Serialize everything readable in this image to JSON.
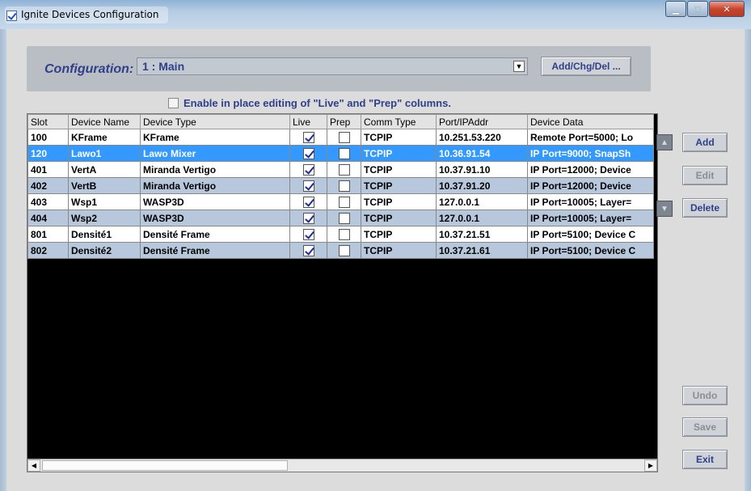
{
  "window": {
    "title": "Ignite Devices Configuration",
    "minimize_icon": "minimize-icon",
    "maximize_icon": "maximize-icon",
    "close_icon": "close-icon"
  },
  "config": {
    "label": "Configuration:",
    "selected": "1 : Main",
    "add_chg_del_label": "Add/Chg/Del ..."
  },
  "enable_editing": {
    "label": "Enable in place editing of \"Live\" and \"Prep\" columns.",
    "checked": false
  },
  "table": {
    "columns": [
      "Slot",
      "Device Name",
      "Device Type",
      "Live",
      "Prep",
      "Comm Type",
      "Port/IPAddr",
      "Device Data"
    ],
    "rows": [
      {
        "slot": "100",
        "name": "KFrame",
        "type": "KFrame",
        "live": true,
        "prep": false,
        "comm": "TCPIP",
        "addr": "10.251.53.220",
        "data": "Remote Port=5000; Lo"
      },
      {
        "slot": "120",
        "name": "Lawo1",
        "type": "Lawo Mixer",
        "live": true,
        "prep": false,
        "comm": "TCPIP",
        "addr": "10.36.91.54",
        "data": "IP Port=9000; SnapSh"
      },
      {
        "slot": "401",
        "name": "VertA",
        "type": "Miranda Vertigo",
        "live": true,
        "prep": false,
        "comm": "TCPIP",
        "addr": "10.37.91.10",
        "data": "IP Port=12000; Device"
      },
      {
        "slot": "402",
        "name": "VertB",
        "type": "Miranda Vertigo",
        "live": true,
        "prep": false,
        "comm": "TCPIP",
        "addr": "10.37.91.20",
        "data": "IP Port=12000; Device"
      },
      {
        "slot": "403",
        "name": "Wsp1",
        "type": "WASP3D",
        "live": true,
        "prep": false,
        "comm": "TCPIP",
        "addr": "127.0.0.1",
        "data": "IP Port=10005; Layer="
      },
      {
        "slot": "404",
        "name": "Wsp2",
        "type": "WASP3D",
        "live": true,
        "prep": false,
        "comm": "TCPIP",
        "addr": "127.0.0.1",
        "data": "IP Port=10005; Layer="
      },
      {
        "slot": "801",
        "name": "Densité1",
        "type": "Densité Frame",
        "live": true,
        "prep": false,
        "comm": "TCPIP",
        "addr": "10.37.21.51",
        "data": "IP Port=5100; Device C"
      },
      {
        "slot": "802",
        "name": "Densité2",
        "type": "Densité Frame",
        "live": true,
        "prep": false,
        "comm": "TCPIP",
        "addr": "10.37.21.61",
        "data": "IP Port=5100; Device C"
      }
    ],
    "selected_row": 1
  },
  "buttons": {
    "add": "Add",
    "edit": "Edit",
    "delete": "Delete",
    "undo": "Undo",
    "save": "Save",
    "exit": "Exit"
  },
  "colors": {
    "accent_text": "#2f3f89",
    "selection": "#3399ff",
    "alt_row": "#b8c8dc"
  }
}
